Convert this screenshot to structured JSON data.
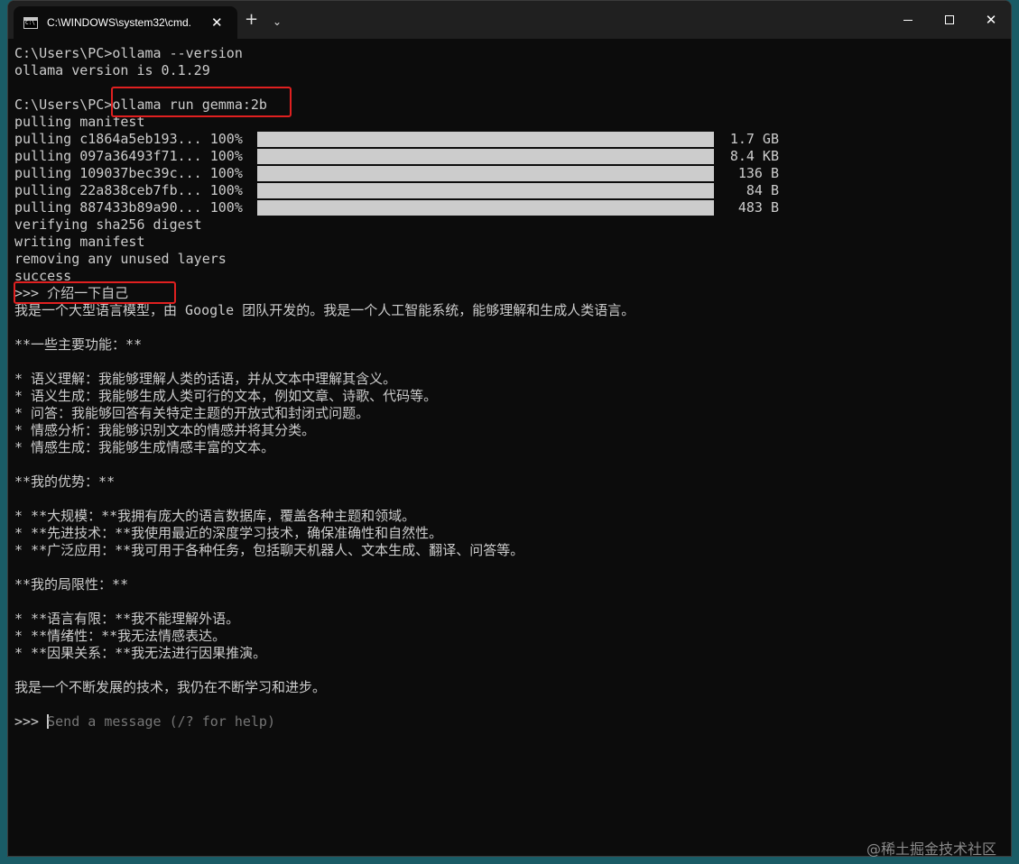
{
  "window": {
    "tab_title": "C:\\WINDOWS\\system32\\cmd.",
    "tab_close": "✕",
    "new_tab": "+",
    "dropdown": "⌄",
    "close_glyph": "✕"
  },
  "terminal": {
    "lines": [
      "C:\\Users\\PC>ollama --version",
      "ollama version is 0.1.29",
      "",
      "C:\\Users\\PC>ollama run gemma:2b",
      "pulling manifest"
    ],
    "pulls": [
      {
        "label": "pulling c1864a5eb193... 100%",
        "size": "1.7 GB",
        "progress": 1.0
      },
      {
        "label": "pulling 097a36493f71... 100%",
        "size": "8.4 KB",
        "progress": 1.0
      },
      {
        "label": "pulling 109037bec39c... 100%",
        "size": "136 B",
        "progress": 1.0
      },
      {
        "label": "pulling 22a838ceb7fb... 100%",
        "size": "84 B",
        "progress": 1.0
      },
      {
        "label": "pulling 887433b89a90... 100%",
        "size": "483 B",
        "progress": 1.0
      }
    ],
    "after_pull": [
      "verifying sha256 digest",
      "writing manifest",
      "removing any unused layers",
      "success",
      ">>> 介绍一下自己",
      "我是一个大型语言模型，由 Google 团队开发的。我是一个人工智能系统，能够理解和生成人类语言。",
      "",
      "**一些主要功能：**",
      "",
      "* 语义理解：我能够理解人类的话语，并从文本中理解其含义。",
      "* 语义生成：我能够生成人类可行的文本，例如文章、诗歌、代码等。",
      "* 问答：我能够回答有关特定主题的开放式和封闭式问题。",
      "* 情感分析：我能够识别文本的情感并将其分类。",
      "* 情感生成：我能够生成情感丰富的文本。",
      "",
      "**我的优势：**",
      "",
      "* **大规模：**我拥有庞大的语言数据库，覆盖各种主题和领域。",
      "* **先进技术：**我使用最近的深度学习技术，确保准确性和自然性。",
      "* **广泛应用：**我可用于各种任务，包括聊天机器人、文本生成、翻译、问答等。",
      "",
      "**我的局限性：**",
      "",
      "* **语言有限：**我不能理解外语。",
      "* **情绪性：**我无法情感表达。",
      "* **因果关系：**我无法进行因果推演。",
      "",
      "我是一个不断发展的技术，我仍在不断学习和进步。",
      ""
    ],
    "prompt": ">>> ",
    "input_placeholder": "Send a message (/? for help)"
  },
  "watermark": "@稀土掘金技术社区",
  "colors": {
    "background": "#0c0c0c",
    "text": "#cccccc",
    "highlight": "#e02020"
  }
}
